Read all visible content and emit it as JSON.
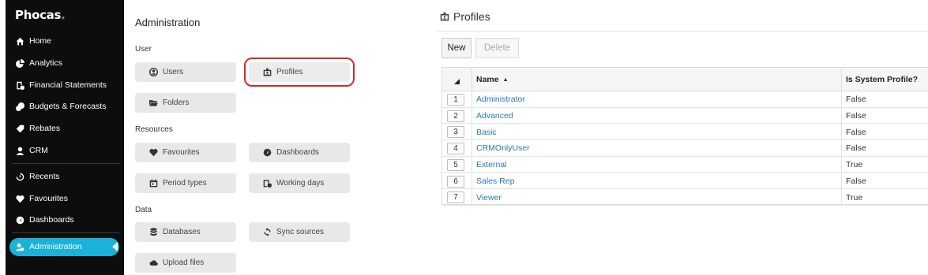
{
  "brand": {
    "name": "Phocas",
    "dot": "."
  },
  "sidebar": {
    "items": [
      {
        "label": "Home",
        "icon": "home-icon"
      },
      {
        "label": "Analytics",
        "icon": "pie-chart-icon"
      },
      {
        "label": "Financial Statements",
        "icon": "financial-statements-icon"
      },
      {
        "label": "Budgets & Forecasts",
        "icon": "budgets-icon"
      },
      {
        "label": "Rebates",
        "icon": "rebates-tag-icon"
      },
      {
        "label": "CRM",
        "icon": "crm-person-icon"
      },
      {
        "label": "Recents",
        "icon": "history-icon"
      },
      {
        "label": "Favourites",
        "icon": "heart-icon"
      },
      {
        "label": "Dashboards",
        "icon": "gauge-icon"
      },
      {
        "label": "Administration",
        "icon": "admin-users-icon",
        "active": true
      }
    ]
  },
  "admin": {
    "title": "Administration",
    "sections": {
      "user": "User",
      "resources": "Resources",
      "data": "Data"
    },
    "tiles": {
      "users": "Users",
      "profiles": "Profiles",
      "folders": "Folders",
      "favourites": "Favourites",
      "dashboards": "Dashboards",
      "period_types": "Period types",
      "working_days": "Working days",
      "databases": "Databases",
      "sync_sources": "Sync sources",
      "upload_files": "Upload files"
    }
  },
  "profiles": {
    "title": "Profiles",
    "toolbar": {
      "new": "New",
      "delete": "Delete"
    },
    "columns": {
      "name": "Name",
      "system": "Is System Profile?"
    },
    "rows": [
      {
        "num": "1",
        "name": "Administrator",
        "system": "False"
      },
      {
        "num": "2",
        "name": "Advanced",
        "system": "False"
      },
      {
        "num": "3",
        "name": "Basic",
        "system": "False"
      },
      {
        "num": "4",
        "name": "CRMOnlyUser",
        "system": "False"
      },
      {
        "num": "5",
        "name": "External",
        "system": "True"
      },
      {
        "num": "6",
        "name": "Sales Rep",
        "system": "False"
      },
      {
        "num": "7",
        "name": "Viewer",
        "system": "True"
      }
    ]
  },
  "colors": {
    "sidebar_bg": "#0d0d0d",
    "active_accent": "#1ab2d8",
    "link": "#2a79b4",
    "highlight_border": "#d32b2b"
  }
}
